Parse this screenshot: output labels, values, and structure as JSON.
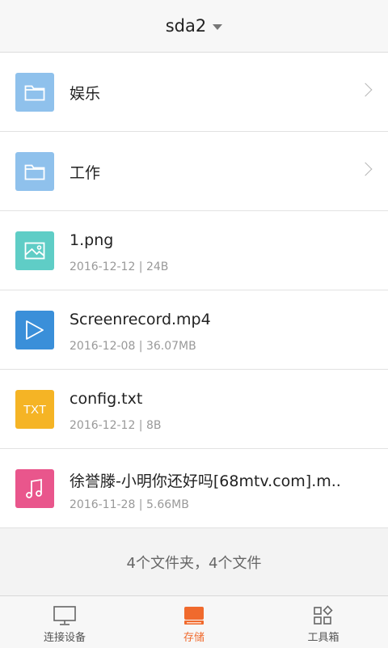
{
  "header": {
    "title": "sda2"
  },
  "colors": {
    "folder": "#8fc1ec",
    "image": "#5fcdc6",
    "video": "#3a8fd9",
    "text": "#f5b425",
    "music": "#e9568c",
    "active_tab": "#f06a2d"
  },
  "items": [
    {
      "type": "folder",
      "icon": "folder-icon",
      "name": "娱乐"
    },
    {
      "type": "folder",
      "icon": "folder-icon",
      "name": "工作"
    },
    {
      "type": "file",
      "icon": "image-file-icon",
      "name": "1.png",
      "meta": "2016-12-12 | 24B"
    },
    {
      "type": "file",
      "icon": "video-file-icon",
      "name": "Screenrecord.mp4",
      "meta": "2016-12-08 | 36.07MB"
    },
    {
      "type": "file",
      "icon": "text-file-icon",
      "icon_text": "TXT",
      "name": "config.txt",
      "meta": "2016-12-12 | 8B"
    },
    {
      "type": "file",
      "icon": "music-file-icon",
      "name": "徐誉滕-小明你还好吗[68mtv.com].m..",
      "meta": "2016-11-28 | 5.66MB"
    }
  ],
  "summary": "4个文件夹，4个文件",
  "tabs": [
    {
      "label": "连接设备",
      "icon": "monitor-icon",
      "active": false
    },
    {
      "label": "存储",
      "icon": "storage-icon",
      "active": true
    },
    {
      "label": "工具箱",
      "icon": "toolbox-icon",
      "active": false
    }
  ]
}
